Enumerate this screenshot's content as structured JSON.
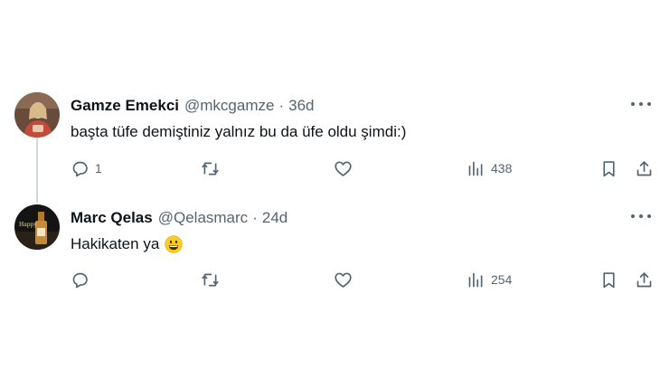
{
  "tweets": [
    {
      "author_name": "Gamze Emekci",
      "handle": "@mkcgamze",
      "separator": "·",
      "time": "36d",
      "text": "başta tüfe demiştiniz yalnız bu da üfe oldu şimdi:)",
      "reply_count": "1",
      "retweet_count": "",
      "like_count": "",
      "view_count": "438",
      "more_icon": "more-icon"
    },
    {
      "author_name": "Marc Qelas",
      "handle": "@Qelasmarc",
      "separator": "·",
      "time": "24d",
      "text": "Hakikaten ya",
      "emoji": "grinning-face",
      "avatar_caption": "Happy",
      "reply_count": "",
      "retweet_count": "",
      "like_count": "",
      "view_count": "254",
      "more_icon": "more-icon"
    }
  ],
  "colors": {
    "text": "#0f1419",
    "secondary": "#536471",
    "thread_line": "#cfd9de",
    "background": "#ffffff"
  }
}
